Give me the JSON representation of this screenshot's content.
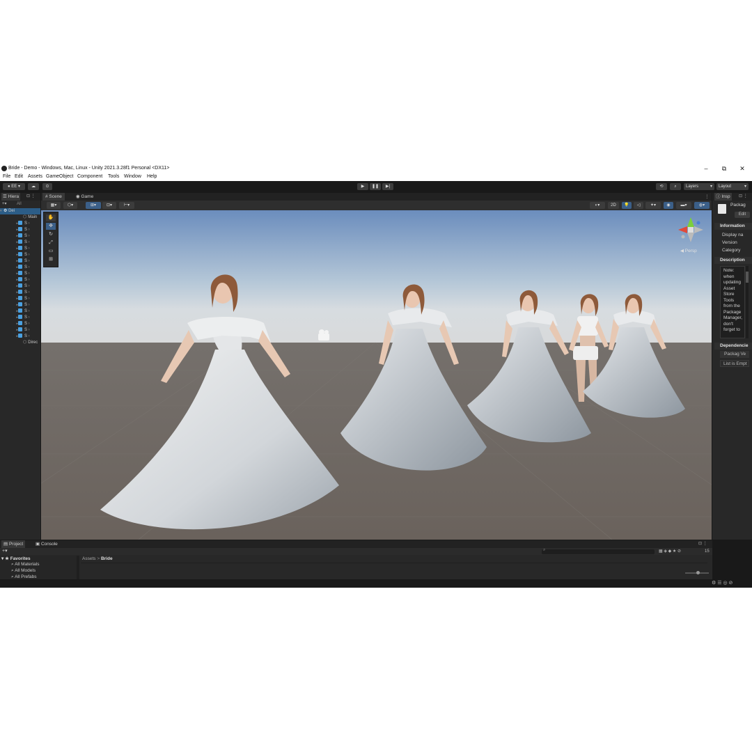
{
  "window": {
    "title": "Bride - Demo - Windows, Mac, Linux - Unity 2021.3.28f1 Personal <DX11>",
    "controls": {
      "minimize": "–",
      "maximize": "⧉",
      "close": "✕"
    }
  },
  "menu": [
    "File",
    "Edit",
    "Assets",
    "GameObject",
    "Component",
    "Tools",
    "Window",
    "Help"
  ],
  "toolbar": {
    "account": "EE",
    "layers": "Layers",
    "layout": "Layout"
  },
  "hierarchy": {
    "tab": "Hiera",
    "search_placeholder": "All",
    "scene_name": "Dei",
    "items": [
      {
        "label": "Main",
        "type": "object"
      },
      {
        "label": "S",
        "type": "prefab"
      },
      {
        "label": "S",
        "type": "prefab"
      },
      {
        "label": "S",
        "type": "prefab"
      },
      {
        "label": "S",
        "type": "prefab"
      },
      {
        "label": "S",
        "type": "prefab"
      },
      {
        "label": "S",
        "type": "prefab"
      },
      {
        "label": "S",
        "type": "prefab"
      },
      {
        "label": "S",
        "type": "prefab"
      },
      {
        "label": "S",
        "type": "prefab"
      },
      {
        "label": "S",
        "type": "prefab"
      },
      {
        "label": "S",
        "type": "prefab"
      },
      {
        "label": "S",
        "type": "prefab"
      },
      {
        "label": "S",
        "type": "prefab"
      },
      {
        "label": "S",
        "type": "prefab"
      },
      {
        "label": "S",
        "type": "prefab"
      },
      {
        "label": "S",
        "type": "prefab"
      },
      {
        "label": "S",
        "type": "prefab"
      },
      {
        "label": "S",
        "type": "prefab"
      },
      {
        "label": "S",
        "type": "prefab"
      },
      {
        "label": "Direc",
        "type": "object"
      }
    ]
  },
  "scene": {
    "tabs": [
      "Scene",
      "Game"
    ],
    "btn_2d": "2D",
    "gizmo_label": "◀ Persp"
  },
  "inspector": {
    "tab": "Insp",
    "package_title": "Packag",
    "edit_button": "Edit",
    "information_header": "Information",
    "fields": [
      "Display na",
      "Version",
      "Category"
    ],
    "description_header": "Description",
    "description_text": "Note: when updating Asset Store Tools from the Package Manager, don't forget to",
    "dependencies_header": "Dependencie",
    "dependency_columns": "Packag Ve",
    "dependency_empty": "List is Empt"
  },
  "project": {
    "tabs": [
      "Project",
      "Console"
    ],
    "favorites_label": "Favorites",
    "favorites": [
      "All Materials",
      "All Models",
      "All Prefabs"
    ],
    "breadcrumb": [
      "Assets",
      "Bride"
    ],
    "hidden_count": "15"
  },
  "colors": {
    "editor_bg": "#191919",
    "panel_bg": "#282828",
    "accent_blue": "#4a90d9",
    "sky_top": "#6e8fbf",
    "ground": "#6c6460"
  }
}
